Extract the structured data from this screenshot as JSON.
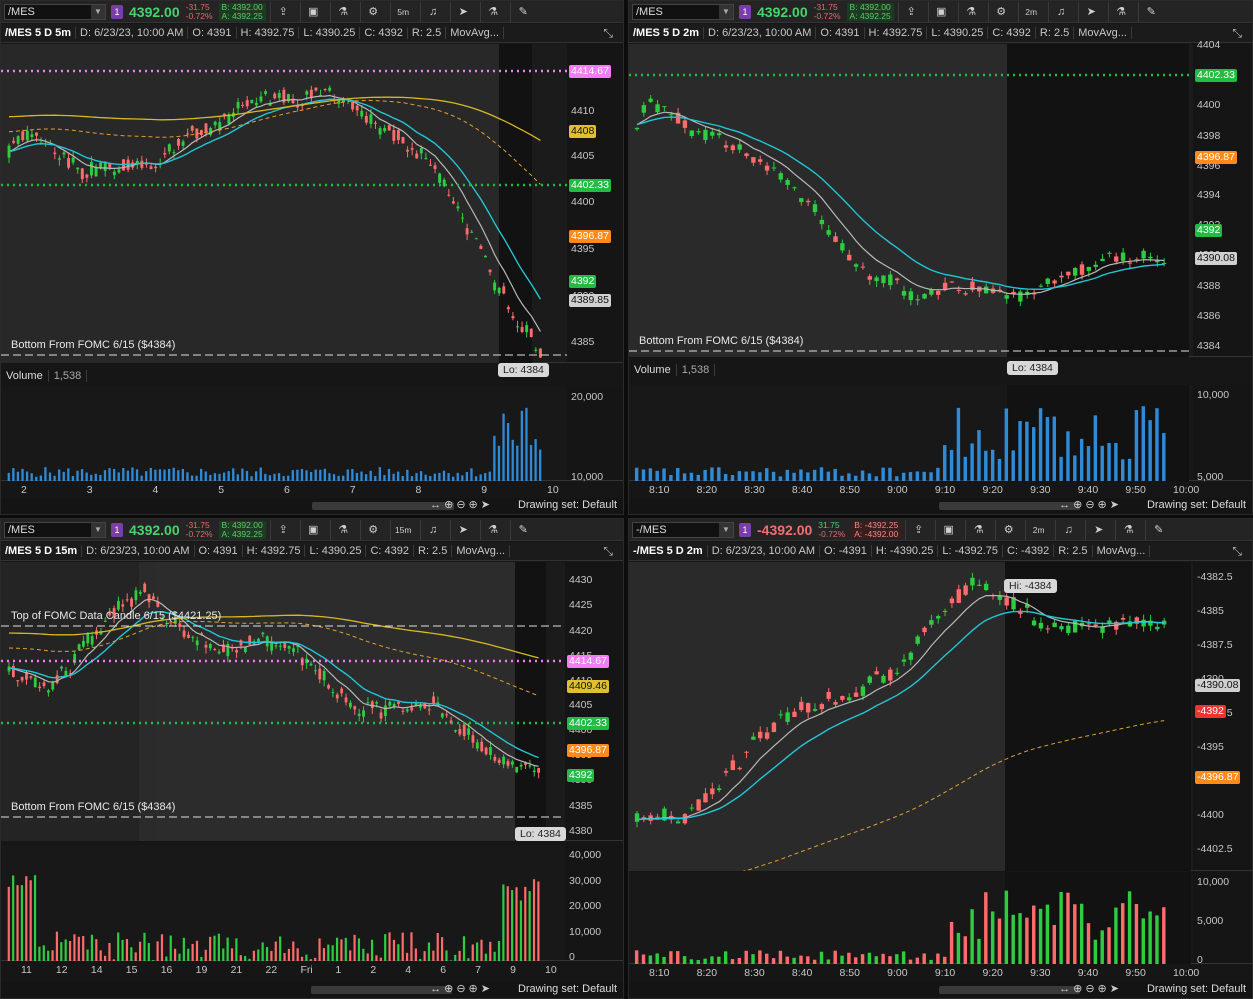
{
  "panes": [
    {
      "id": "tl",
      "symbol": "/MES",
      "last": "4392.00",
      "neg": false,
      "chg": "-31.75",
      "pct": "-0.72%",
      "bid": "B: 4392.00",
      "ask": "A: 4392.25",
      "tf": "5m",
      "title": "/MES 5 D 5m",
      "date": "D: 6/23/23, 10:00 AM",
      "o": "O: 4391",
      "h": "H: 4392.75",
      "l": "L: 4390.25",
      "c": "C: 4392",
      "r": "R: 2.5",
      "ind": "MovAvg...",
      "yticks": [
        "4410",
        "4405",
        "4400",
        "4395",
        "4390",
        "4385"
      ],
      "tags": [
        {
          "t": "4414.67",
          "c": "#f47cf4"
        },
        {
          "t": "4408",
          "c": "#e0c030"
        },
        {
          "t": "4402.33",
          "c": "#22bb44"
        },
        {
          "t": "4396.87",
          "c": "#ff8a1a"
        },
        {
          "t": "4392",
          "c": "#22bb44"
        },
        {
          "t": "4389.85",
          "c": "#d0d0d0"
        }
      ],
      "notes": [
        "Bottom From FOMC 6/15 ($4384)"
      ],
      "bubble": "Lo: 4384",
      "volume_label": "Volume",
      "volume_value": "1,538",
      "vticks": [
        "20,000",
        "10,000"
      ],
      "xticks": [
        "2",
        "3",
        "4",
        "5",
        "6",
        "7",
        "8",
        "9",
        "10"
      ],
      "drawing": "Drawing set: Default"
    },
    {
      "id": "tr",
      "symbol": "/MES",
      "last": "4392.00",
      "neg": false,
      "chg": "-31.75",
      "pct": "-0.72%",
      "bid": "B: 4392.00",
      "ask": "A: 4392.25",
      "tf": "2m",
      "title": "/MES 5 D 2m",
      "date": "D: 6/23/23, 10:00 AM",
      "o": "O: 4391",
      "h": "H: 4392.75",
      "l": "L: 4390.25",
      "c": "C: 4392",
      "r": "R: 2.5",
      "ind": "MovAvg...",
      "yticks": [
        "4404",
        "4402",
        "4400",
        "4398",
        "4396",
        "4394",
        "4392",
        "4390",
        "4388",
        "4386",
        "4384"
      ],
      "tags": [
        {
          "t": "4402.33",
          "c": "#22bb44"
        },
        {
          "t": "4396.87",
          "c": "#ff8a1a"
        },
        {
          "t": "4392",
          "c": "#22bb44"
        },
        {
          "t": "4390.08",
          "c": "#d0d0d0"
        }
      ],
      "notes": [
        "Bottom From FOMC 6/15 ($4384)"
      ],
      "bubble": "Lo: 4384",
      "volume_label": "Volume",
      "volume_value": "1,538",
      "vticks": [
        "10,000",
        "5,000"
      ],
      "xticks": [
        "8:10",
        "8:20",
        "8:30",
        "8:40",
        "8:50",
        "9:00",
        "9:10",
        "9:20",
        "9:30",
        "9:40",
        "9:50",
        "10:00"
      ],
      "drawing": "Drawing set: Default"
    },
    {
      "id": "bl",
      "symbol": "/MES",
      "last": "4392.00",
      "neg": false,
      "chg": "-31.75",
      "pct": "-0.72%",
      "bid": "B: 4392.00",
      "ask": "A: 4392.25",
      "tf": "15m",
      "title": "/MES 5 D 15m",
      "date": "D: 6/23/23, 10:00 AM",
      "o": "O: 4391",
      "h": "H: 4392.75",
      "l": "L: 4390.25",
      "c": "C: 4392",
      "r": "R: 2.5",
      "ind": "MovAvg...",
      "yticks": [
        "4430",
        "4425",
        "4420",
        "4415",
        "4410",
        "4405",
        "4400",
        "4395",
        "4390",
        "4385",
        "4380"
      ],
      "tags": [
        {
          "t": "4414.67",
          "c": "#f47cf4"
        },
        {
          "t": "4409.46",
          "c": "#e0c030"
        },
        {
          "t": "4402.33",
          "c": "#22bb44"
        },
        {
          "t": "4396.87",
          "c": "#ff8a1a"
        },
        {
          "t": "4392",
          "c": "#22bb44"
        }
      ],
      "notes": [
        "Top of FOMC Data Candle 6/15 ($4421.25)",
        "Bottom From FOMC 6/15 ($4384)"
      ],
      "bubble": "Lo: 4384",
      "volume_label": "Volume",
      "volume_value": "1,538",
      "vticks": [
        "40,000",
        "30,000",
        "20,000",
        "10,000",
        "0"
      ],
      "xticks": [
        "11",
        "12",
        "14",
        "15",
        "16",
        "19",
        "21",
        "22",
        "Fri",
        "1",
        "2",
        "4",
        "6",
        "7",
        "9",
        "10"
      ],
      "drawing": "Drawing set: Default"
    },
    {
      "id": "br",
      "symbol": "-/MES",
      "last": "-4392.00",
      "neg": true,
      "chg": "31.75",
      "pct": "-0.72%",
      "bid": "B: -4392.25",
      "ask": "A: -4392.00",
      "tf": "2m",
      "title": "-/MES 5 D 2m",
      "date": "D: 6/23/23, 10:00 AM",
      "o": "O: -4391",
      "h": "H: -4390.25",
      "l": "L: -4392.75",
      "c": "C: -4392",
      "r": "R: 2.5",
      "ind": "MovAvg...",
      "yticks": [
        "-4382.5",
        "-4385",
        "-4387.5",
        "-4390",
        "-4392.5",
        "-4395",
        "-4397.5",
        "-4400",
        "-4402.5"
      ],
      "tags": [
        {
          "t": "-4390.08",
          "c": "#d0d0d0"
        },
        {
          "t": "-4392",
          "c": "#ee3333"
        },
        {
          "t": "-4396.87",
          "c": "#ff8a1a"
        }
      ],
      "notes": [],
      "bubble": "Hi: -4384",
      "volume_label": "Volume",
      "volume_value": "1,538",
      "vticks": [
        "10,000",
        "5,000",
        "0"
      ],
      "xticks": [
        "8:10",
        "8:20",
        "8:30",
        "8:40",
        "8:50",
        "9:00",
        "9:10",
        "9:20",
        "9:30",
        "9:40",
        "9:50",
        "10:00"
      ],
      "drawing": "Drawing set: Default"
    }
  ]
}
